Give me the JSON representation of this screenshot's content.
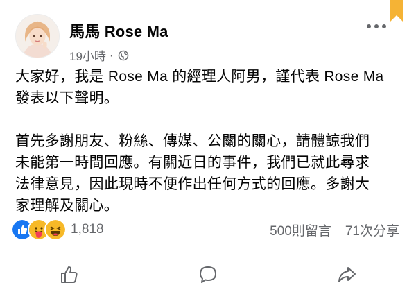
{
  "post": {
    "author": "馬馬 Rose Ma",
    "time": "19小時",
    "separator": "·",
    "audience_icon": "globe-icon",
    "paragraphs": [
      "大家好，我是 Rose Ma 的經理人阿男，謹代表 Rose Ma\n發表以下聲明。",
      "首先多謝朋友、粉絲、傳媒、公關的關心，請體諒我們\n未能第一時間回應。有關近日的事件，我們已就此尋求\n法律意見，因此現時不便作出任何方式的回應。多謝大\n家理解及關心。"
    ]
  },
  "reactions": {
    "icons": [
      "like-icon",
      "care-icon",
      "haha-icon"
    ],
    "count": "1,818",
    "comments": "500則留言",
    "shares": "71次分享"
  },
  "actions": [
    {
      "icon": "thumbs-up-icon"
    },
    {
      "icon": "comment-icon"
    },
    {
      "icon": "share-icon"
    }
  ],
  "colors": {
    "text": "#050505",
    "secondary": "#65676b",
    "like_blue": "#1877f2",
    "haha_yellow": "#f7b928",
    "bookmark": "#f5b335"
  }
}
